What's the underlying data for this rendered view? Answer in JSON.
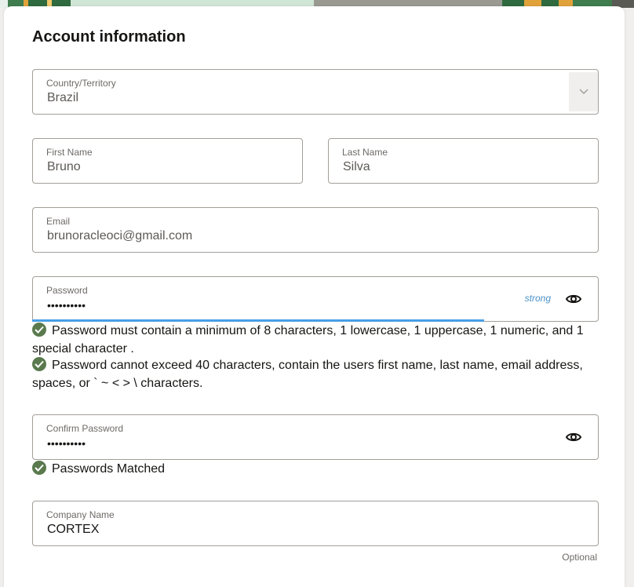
{
  "section_title": "Account information",
  "country": {
    "label": "Country/Territory",
    "value": "Brazil"
  },
  "first_name": {
    "label": "First Name",
    "value": "Bruno"
  },
  "last_name": {
    "label": "Last Name",
    "value": "Silva"
  },
  "email": {
    "label": "Email",
    "value": "brunoracleoci@gmail.com"
  },
  "password": {
    "label": "Password",
    "value": "••••••••••",
    "strength": "strong",
    "strength_fraction": 0.8,
    "rules": [
      "Password must contain a minimum of 8 characters, 1 lowercase, 1 uppercase, 1 numeric, and 1 special character .",
      "Password cannot exceed 40 characters, contain the users first name, last name, email address, spaces, or ` ~ < > \\ characters."
    ]
  },
  "confirm_password": {
    "label": "Confirm Password",
    "value": "••••••••••",
    "match_message": "Passwords Matched"
  },
  "company": {
    "label": "Company Name",
    "value": "CORTEX",
    "hint": "Optional"
  },
  "icons": {
    "dropdown": "chevron-down-icon",
    "reveal": "eye-icon",
    "valid": "check-circle-icon"
  },
  "colors": {
    "accent": "#4a9ee6",
    "strength_text": "#4a90c8",
    "valid": "#5a7a4e"
  }
}
